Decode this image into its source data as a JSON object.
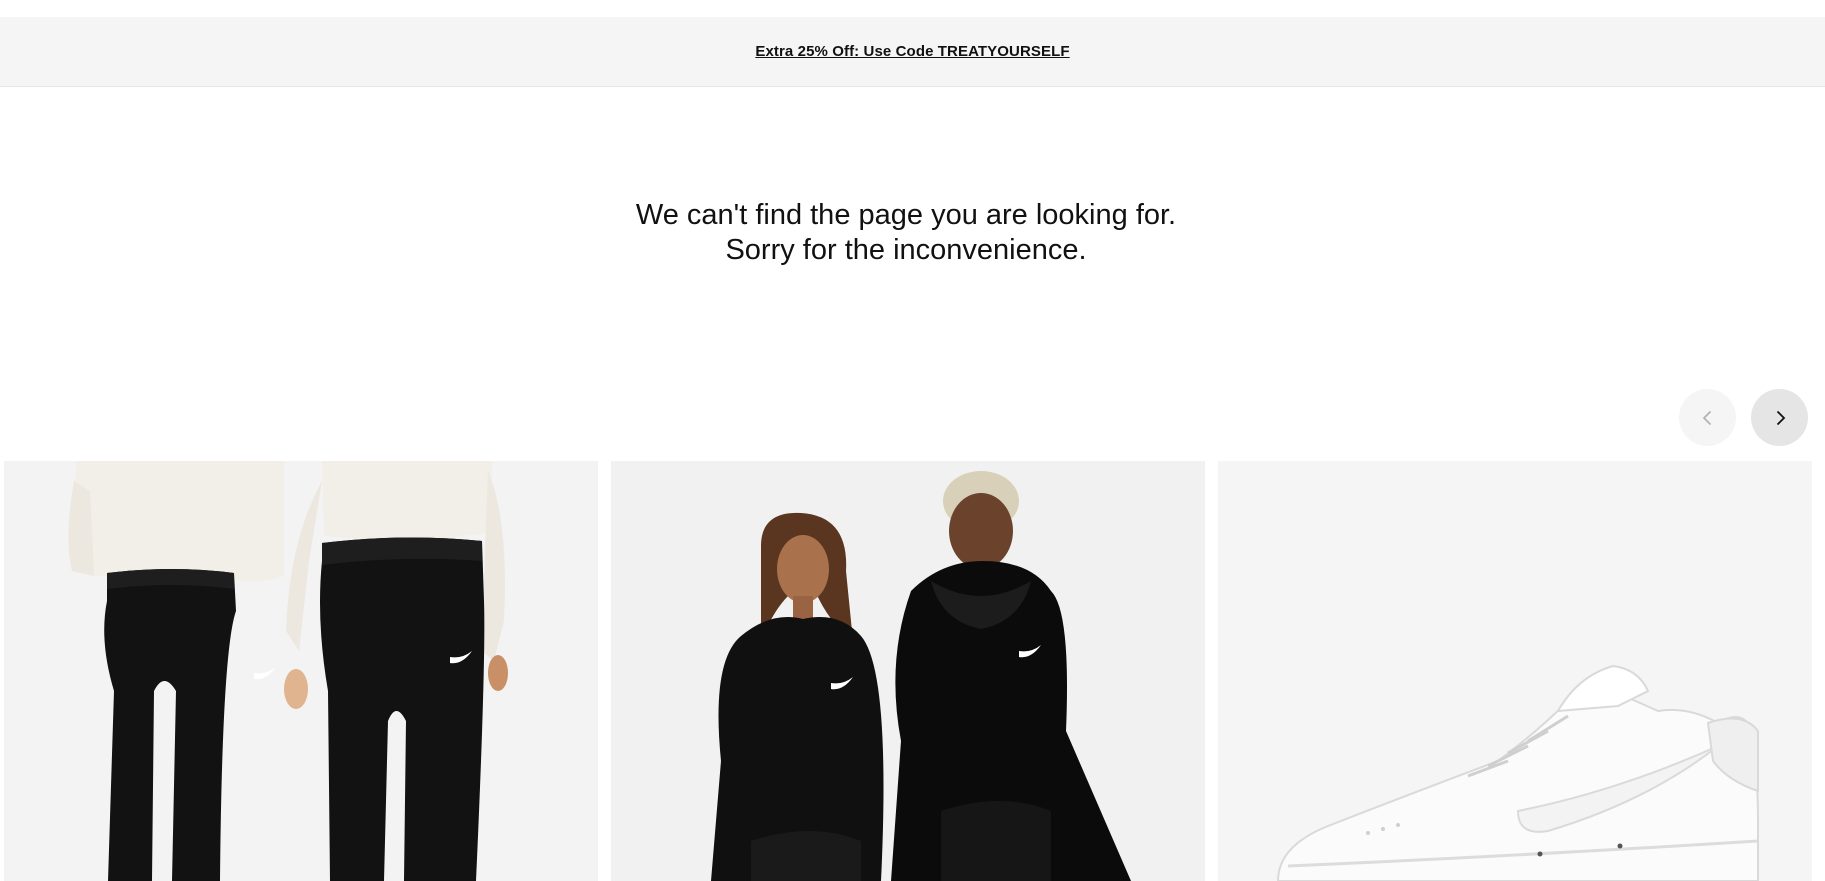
{
  "promo": {
    "text": "Extra 25% Off: Use Code TREATYOURSELF"
  },
  "error": {
    "line1": "We can't find the page you are looking for.",
    "line2": "Sorry for the inconvenience."
  },
  "carousel": {
    "prev_icon": "chevron-left-icon",
    "next_icon": "chevron-right-icon",
    "prev_disabled": true,
    "products": [
      {
        "image": "black-fleece-joggers-photo",
        "background": "#f3f3f3"
      },
      {
        "image": "black-pullover-hoodies-photo",
        "background": "#f1f1f1"
      },
      {
        "image": "white-low-top-sneaker-photo",
        "background": "#f5f5f5"
      }
    ]
  }
}
